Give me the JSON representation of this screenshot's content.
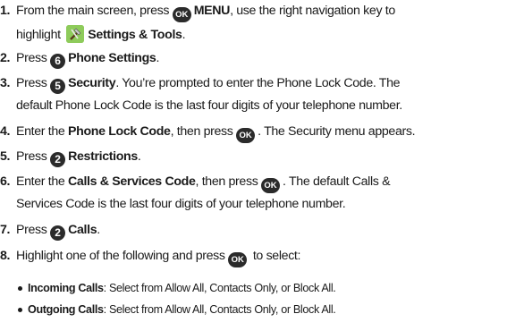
{
  "steps": [
    {
      "num": "1.",
      "p1": "From the main screen, press ",
      "key1": "OK",
      "b1": "MENU",
      "p2": ", use the right navigation key to",
      "p3": "highlight ",
      "icon": "settings-tools-icon",
      "b2": "Settings & Tools",
      "p4": "."
    },
    {
      "num": "2.",
      "p1": "Press ",
      "key1": "6",
      "b1": "Phone Settings",
      "p2": "."
    },
    {
      "num": "3.",
      "p1": "Press ",
      "key1": "5",
      "b1": "Security",
      "p2": ". You’re prompted to enter the Phone Lock Code. The",
      "p3": "default Phone Lock Code is the last four digits of your telephone number."
    },
    {
      "num": "4.",
      "p1": "Enter the ",
      "b1": "Phone Lock Code",
      "p2": ", then press ",
      "key1": "OK",
      "p3": ". The Security menu appears."
    },
    {
      "num": "5.",
      "p1": "Press ",
      "key1": "2",
      "b1": "Restrictions",
      "p2": "."
    },
    {
      "num": "6.",
      "p1": "Enter the ",
      "b1": "Calls & Services Code",
      "p2": ", then press ",
      "key1": "OK",
      "p3": ". The default Calls &",
      "p4": "Services Code is the last four digits of your telephone number."
    },
    {
      "num": "7.",
      "p1": "Press ",
      "key1": "2",
      "b1": "Calls",
      "p2": "."
    },
    {
      "num": "8.",
      "p1": "Highlight one of the following and press ",
      "key1": "OK",
      "p2": " to select:"
    }
  ],
  "bullets": [
    {
      "b": "Incoming Calls",
      "t": ": Select from Allow All, Contacts Only, or Block All."
    },
    {
      "b": "Outgoing Calls",
      "t": ": Select from Allow All, Contacts Only, or Block All."
    }
  ],
  "colors": {
    "text": "#1a1a1a",
    "key_bg": "#2b2b2b",
    "tools_icon_bg": "#8ecb5b"
  }
}
